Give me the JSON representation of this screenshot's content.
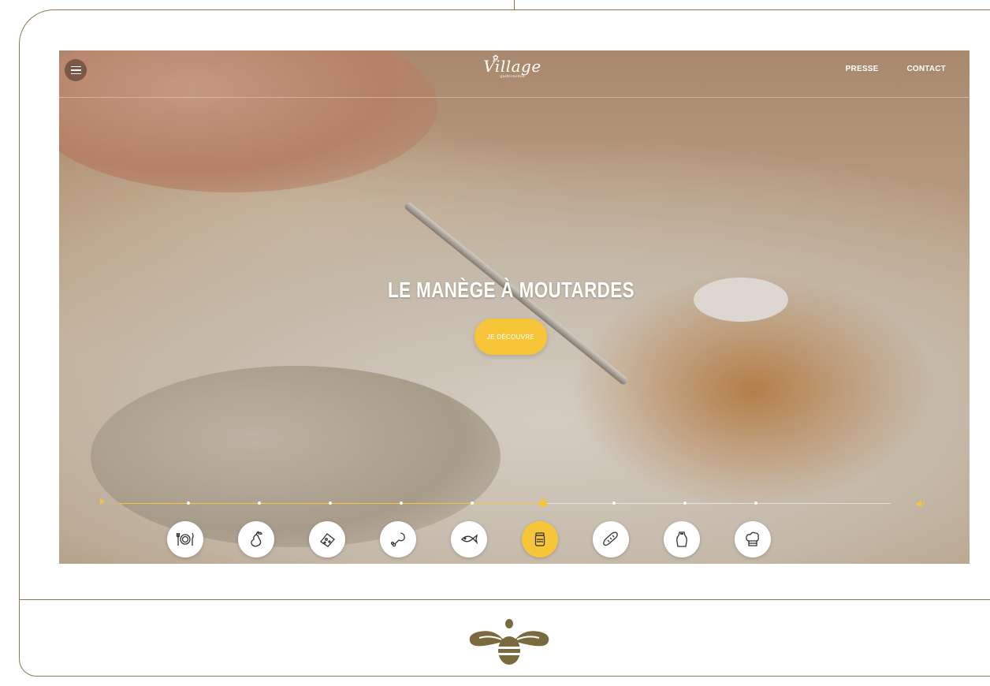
{
  "header": {
    "logo_text": "Village",
    "logo_tagline": "gastronomie",
    "nav": [
      {
        "label": "PRESSE"
      },
      {
        "label": "CONTACT"
      }
    ]
  },
  "hero": {
    "title": "LE MANÈGE À MOUTARDES",
    "cta_label": "JE DÉCOUVRE"
  },
  "timeline": {
    "current_index": 5,
    "total_steps": 9
  },
  "categories": [
    {
      "icon": "plate-cutlery-icon"
    },
    {
      "icon": "pear-icon"
    },
    {
      "icon": "cheese-icon"
    },
    {
      "icon": "chicken-leg-icon"
    },
    {
      "icon": "fish-icon"
    },
    {
      "icon": "mustard-jar-icon"
    },
    {
      "icon": "baguette-icon"
    },
    {
      "icon": "salt-shaker-icon"
    },
    {
      "icon": "chef-hat-icon"
    }
  ],
  "colors": {
    "accent": "#f6c53a",
    "frame": "#8a7a4e",
    "bee_logo": "#7a6a3d"
  }
}
